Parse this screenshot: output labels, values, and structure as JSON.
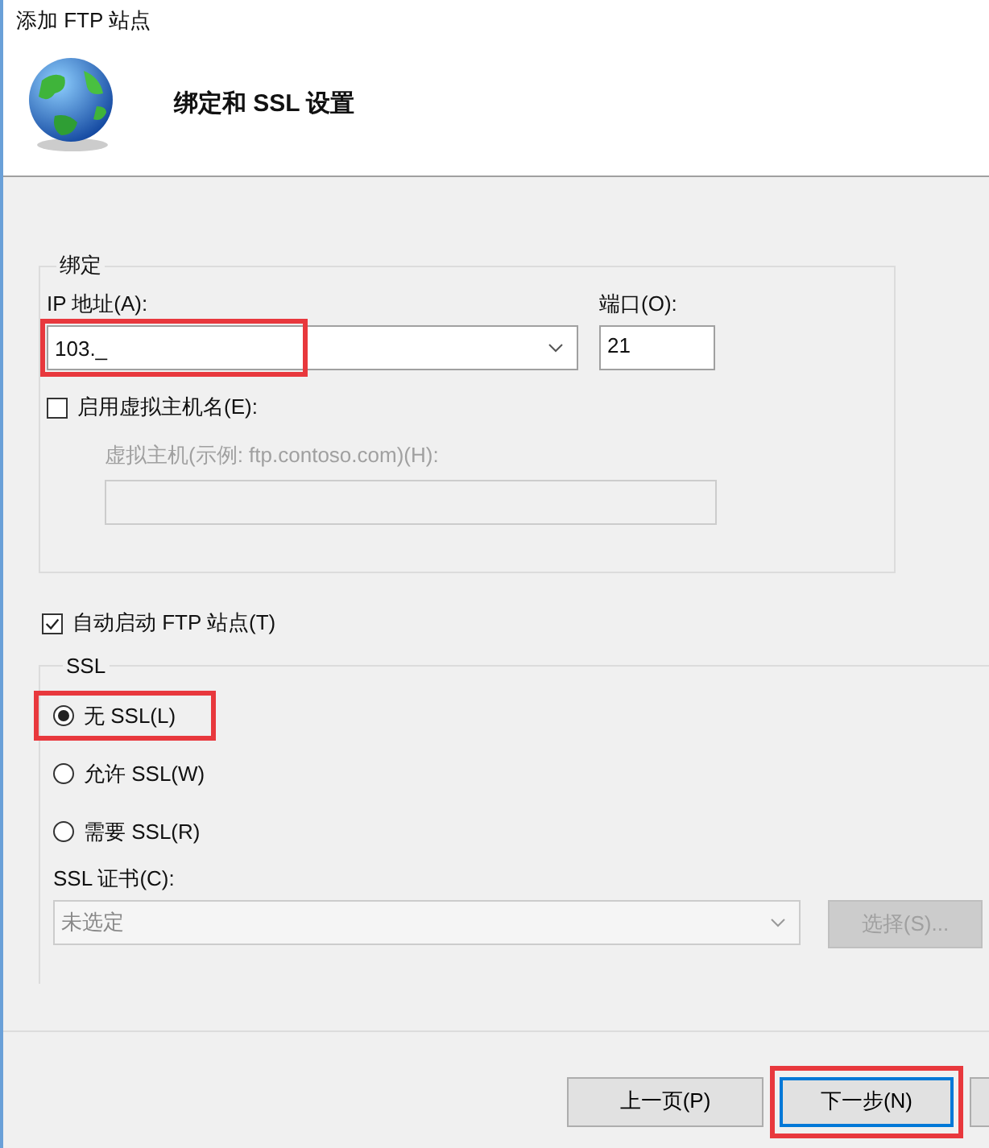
{
  "window": {
    "title": "添加 FTP 站点"
  },
  "header": {
    "title": "绑定和 SSL 设置"
  },
  "binding": {
    "legend": "绑定",
    "ip_label": "IP 地址(A):",
    "ip_value": "103._",
    "ip_highlighted": true,
    "port_label": "端口(O):",
    "port_value": "21",
    "virtual_host": {
      "label": "启用虚拟主机名(E):",
      "checked": false
    },
    "host_label": "虚拟主机(示例: ftp.contoso.com)(H):",
    "host_disabled": true
  },
  "auto_start": {
    "label": "自动启动 FTP 站点(T)",
    "checked": true
  },
  "ssl": {
    "legend": "SSL",
    "options": [
      {
        "label": "无 SSL(L)",
        "selected": true,
        "highlighted": true
      },
      {
        "label": "允许 SSL(W)",
        "selected": false,
        "highlighted": false
      },
      {
        "label": "需要 SSL(R)",
        "selected": false,
        "highlighted": false
      }
    ],
    "cert_label": "SSL 证书(C):",
    "cert_value": "未选定",
    "select_button": {
      "label": "选择(S)...",
      "disabled": true
    }
  },
  "buttons": [
    {
      "label": "上一页(P)",
      "focused": false,
      "highlighted": false
    },
    {
      "label": "下一步(N)",
      "focused": true,
      "highlighted": true
    }
  ]
}
